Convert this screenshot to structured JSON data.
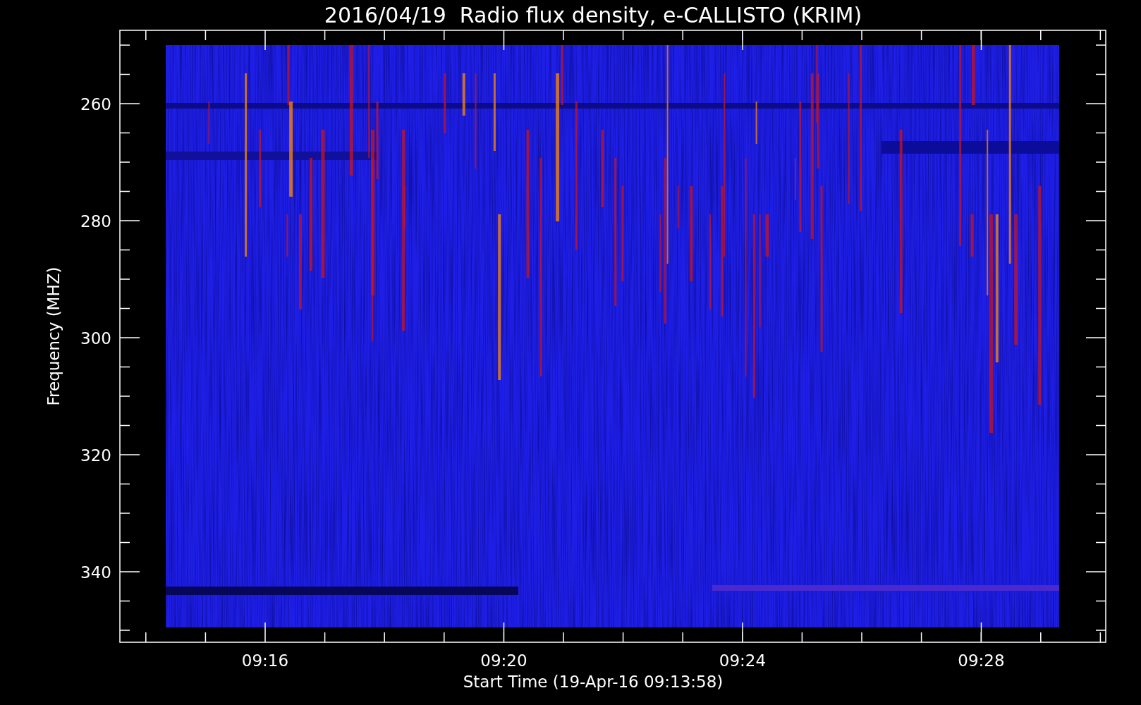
{
  "title": "2016/04/19  Radio flux density, e-CALLISTO (KRIM)",
  "ylabel": "Frequency (MHZ)",
  "xlabel": "Start Time (19-Apr-16 09:13:58)",
  "yticks": [
    "260",
    "280",
    "300",
    "320",
    "340"
  ],
  "xticks": [
    "09:16",
    "09:20",
    "09:24",
    "09:28"
  ]
}
